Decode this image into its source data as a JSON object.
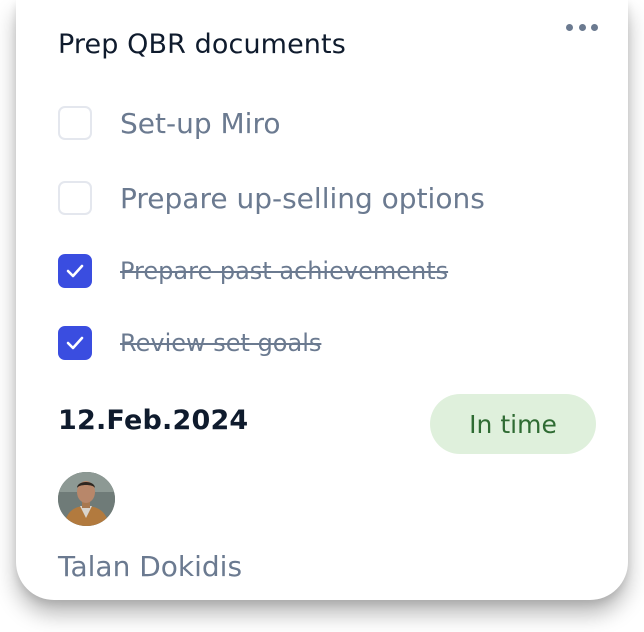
{
  "card": {
    "title": "Prep QBR documents",
    "more_icon": "more-horizontal-icon",
    "tasks": [
      {
        "label": "Set-up Miro",
        "checked": false
      },
      {
        "label": "Prepare up-selling options",
        "checked": false
      },
      {
        "label": "Prepare past achievements",
        "checked": true
      },
      {
        "label": "Review set goals",
        "checked": true
      }
    ],
    "date": "12.Feb.2024",
    "status": "In time",
    "assignee": {
      "name": "Talan Dokidis",
      "avatar_icon": "user-avatar"
    }
  },
  "colors": {
    "accent": "#3a4de0",
    "status_bg": "#dff0dc",
    "status_text": "#2f6b33",
    "muted_text": "#6b7a90",
    "heading_text": "#0f1b2d"
  }
}
